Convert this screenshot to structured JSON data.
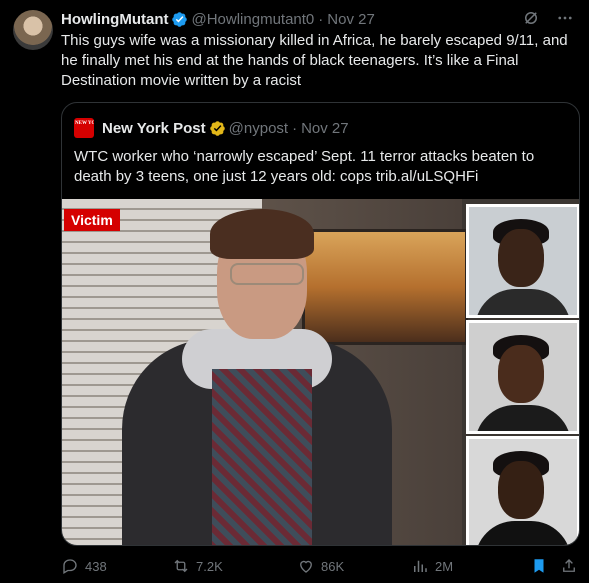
{
  "tweet": {
    "display_name": "HowlingMutant",
    "handle": "@Howlingmutant0",
    "separator": "·",
    "date": "Nov 27",
    "text": "This guys wife was a missionary killed in Africa, he barely escaped 9/11, and he finally met his end at the hands of black teenagers.  It’s like a Final Destination movie written by a racist"
  },
  "quote": {
    "logo_text": "NEW YORK POST",
    "display_name": "New York Post",
    "handle": "@nypost",
    "separator": "·",
    "date": "Nov 27",
    "text": "WTC worker who ‘narrowly escaped’ Sept. 11 terror attacks beaten to death by 3 teens, one just 12 years old: cops trib.al/uLSQHFi",
    "image_tag": "Victim"
  },
  "metrics": {
    "replies": "438",
    "reposts": "7.2K",
    "likes": "86K",
    "views": "2M"
  },
  "colors": {
    "accent": "#1d9bf0",
    "verified_gold": "#e2b719",
    "brand_red": "#d50000",
    "muted": "#71767b"
  },
  "icons": [
    "grok-icon",
    "more-icon",
    "verified-badge-icon",
    "reply-icon",
    "repost-icon",
    "like-icon",
    "views-icon",
    "bookmark-icon",
    "share-icon"
  ]
}
